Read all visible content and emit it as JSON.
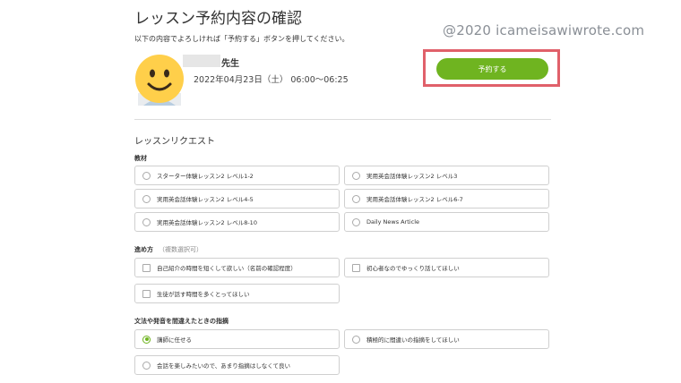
{
  "page": {
    "title": "レッスン予約内容の確認",
    "instruction": "以下の内容でよろしければ「予約する」ボタンを押してください。",
    "watermark": "@2020 icameisawiwrote.com"
  },
  "lesson": {
    "teacher_suffix": "先生",
    "datetime": "2022年04月23日（土） 06:00〜06:25",
    "reserve_label": "予約する"
  },
  "request": {
    "heading": "レッスンリクエスト",
    "materials": {
      "label": "教材",
      "options": [
        {
          "label": "スターター体験レッスン2 レベル1-2",
          "selected": false
        },
        {
          "label": "実用英会話体験レッスン2 レベル3",
          "selected": false
        },
        {
          "label": "実用英会話体験レッスン2 レベル4-5",
          "selected": false
        },
        {
          "label": "実用英会話体験レッスン2 レベル6-7",
          "selected": false
        },
        {
          "label": "実用英会話体験レッスン2 レベル8-10",
          "selected": false
        },
        {
          "label": "Daily News Article",
          "selected": false
        }
      ]
    },
    "approach": {
      "label": "進め方",
      "note": "（複数選択可）",
      "options": [
        {
          "label": "自己紹介の時間を短くして欲しい（名前の確認程度）",
          "checked": false
        },
        {
          "label": "初心者なのでゆっくり話してほしい",
          "checked": false
        },
        {
          "label": "生徒が話す時間を多くとってほしい",
          "checked": false
        }
      ]
    },
    "corrections": {
      "label": "文法や発音を間違えたときの指摘",
      "options": [
        {
          "label": "講師に任せる",
          "selected": true
        },
        {
          "label": "積極的に間違いの指摘をしてほしい",
          "selected": false
        },
        {
          "label": "会話を楽しみたいので、あまり指摘はしなくて良い",
          "selected": false
        }
      ]
    }
  },
  "colors": {
    "accent": "#6fb420",
    "highlight": "#e0606a"
  },
  "icons": {
    "avatar": "smiley-face-icon"
  }
}
